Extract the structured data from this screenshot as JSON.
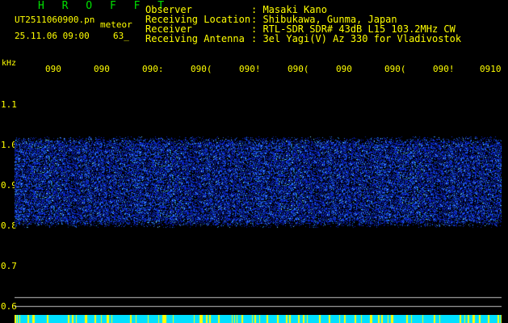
{
  "header": {
    "brand": "H R O F F T",
    "file_name": "UT2511060900.pn",
    "file_tag": "meteor",
    "datetime": "25.11.06 09:00",
    "count": "63_"
  },
  "meta": [
    {
      "label": "Observer",
      "value": ": Masaki Kano"
    },
    {
      "label": "Receiving Location",
      "value": ": Shibukawa, Gunma, Japan"
    },
    {
      "label": "Receiver",
      "value": ": RTL-SDR SDR# 43dB L15 103.2MHz CW"
    },
    {
      "label": "Receiving Antenna",
      "value": ": 3el Yagi(V) Az 330 for Vladivostok"
    }
  ],
  "axis": {
    "unit": "kHz",
    "y_ticks": [
      "1.1",
      "1.0",
      "0.9",
      "0.8",
      "0.7",
      "0.6"
    ],
    "x_ticks": [
      "090",
      "090",
      "090:",
      "090(",
      "090!",
      "090(",
      "090",
      "090(",
      "090!",
      "0910"
    ]
  },
  "colors": {
    "background": "#000000",
    "text": "#ffff00",
    "brand": "#00e000",
    "noise_band": "#0a1aff",
    "bottom_strip": "#00e0ff",
    "grid_line": "#c0c0c0"
  }
}
